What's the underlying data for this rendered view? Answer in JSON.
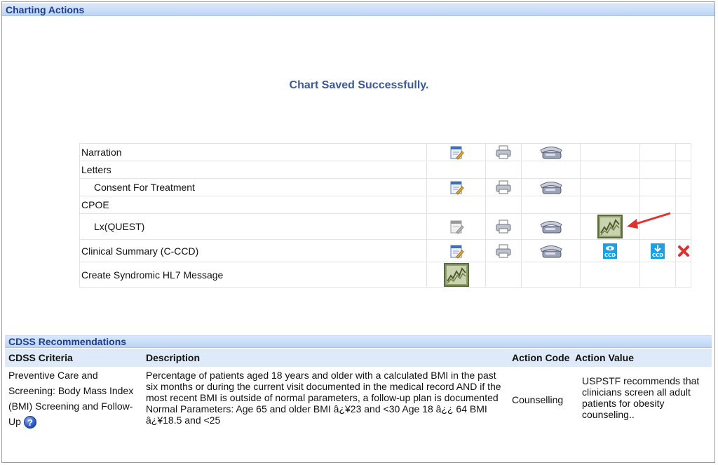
{
  "charting": {
    "title": "Charting Actions",
    "status": "Chart Saved Successfully.",
    "rows": [
      {
        "label": "Narration"
      },
      {
        "label": "Letters"
      },
      {
        "label": "Consent For Treatment"
      },
      {
        "label": "CPOE"
      },
      {
        "label": "Lx(QUEST)"
      },
      {
        "label": "Clinical Summary (C-CCD)"
      },
      {
        "label": "Create Syndromic HL7 Message"
      }
    ],
    "ccd_icon_text": "CCD"
  },
  "cdss": {
    "title": "CDSS Recommendations",
    "columns": {
      "criteria": "CDSS Criteria",
      "description": "Description",
      "action_code": "Action Code",
      "action_value": "Action Value"
    },
    "rows": [
      {
        "criteria": "Preventive Care and Screening: Body Mass Index (BMI) Screening and Follow-Up",
        "description": "Percentage of patients aged 18 years and older with a calculated BMI in the past six months or during the current visit documented in the medical record AND if the most recent BMI is outside of normal parameters, a follow-up plan is documented Normal Parameters: Age 65 and older BMI â¿¥23 and <30 Age 18 â¿¿ 64 BMI â¿¥18.5 and <25",
        "action_code": "Counselling",
        "action_value": "USPSTF recommends that clinicians screen all adult patients for obesity counseling.."
      }
    ],
    "help_glyph": "?"
  },
  "colors": {
    "header_text": "#1e3f8f",
    "status_text": "#3d5a99",
    "arrow": "#e03030",
    "delete": "#e03030"
  },
  "icons": [
    "edit-note-icon",
    "print-icon",
    "fax-icon",
    "lab-chart-icon",
    "view-ccd-icon",
    "download-ccd-icon",
    "delete-icon",
    "help-icon",
    "arrow-annotation-icon"
  ]
}
